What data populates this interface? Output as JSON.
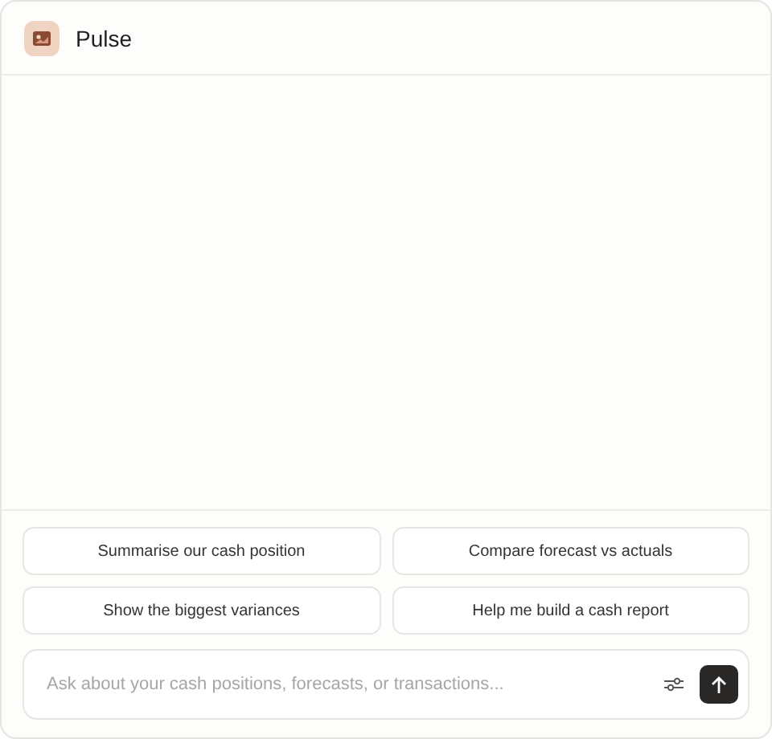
{
  "header": {
    "title": "Pulse"
  },
  "suggestions": [
    "Summarise our cash position",
    "Compare forecast vs actuals",
    "Show the biggest variances",
    "Help me build a cash report"
  ],
  "composer": {
    "placeholder": "Ask about your cash positions, forecasts, or transactions..."
  }
}
